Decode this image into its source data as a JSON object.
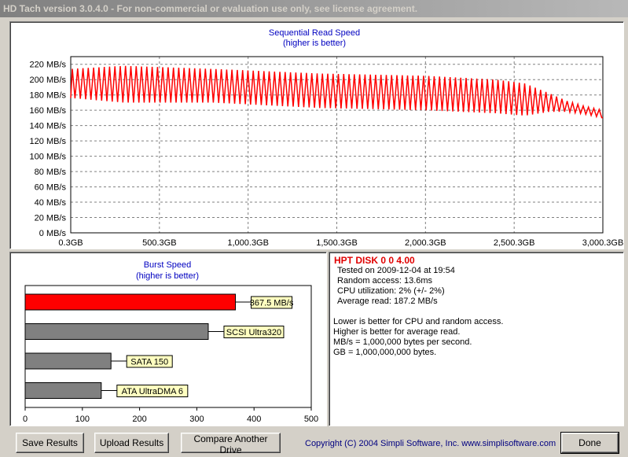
{
  "window": {
    "title": "HD Tach version 3.0.4.0  - For non-commercial or evaluation use only, see license agreement."
  },
  "chart_data": [
    {
      "type": "line",
      "title": "Sequential Read Speed",
      "subtitle": "(higher is better)",
      "ylim": [
        0,
        230
      ],
      "xlim": [
        0.3,
        3000.3
      ],
      "yticks": [
        "0 MB/s",
        "20 MB/s",
        "40 MB/s",
        "60 MB/s",
        "80 MB/s",
        "100 MB/s",
        "120 MB/s",
        "140 MB/s",
        "160 MB/s",
        "180 MB/s",
        "200 MB/s",
        "220 MB/s"
      ],
      "xticks": [
        "0.3GB",
        "500.3GB",
        "1,000.3GB",
        "1,500.3GB",
        "2,000.3GB",
        "2,500.3GB",
        "3,000.3GB"
      ],
      "xtick_values": [
        0.3,
        500.3,
        1000.3,
        1500.3,
        2000.3,
        2500.3,
        3000.3
      ],
      "grid": true,
      "series": [
        {
          "color": "#ff0000",
          "segments": 100,
          "x": [
            0.3,
            3000.3
          ],
          "peaks": [
            [
              0.3,
              214
            ],
            [
              300,
              218
            ],
            [
              800,
              214
            ],
            [
              1400,
              208
            ],
            [
              2000,
              205
            ],
            [
              2400,
              200
            ],
            [
              2560,
              195
            ],
            [
              2700,
              182
            ],
            [
              2800,
              172
            ],
            [
              2900,
              165
            ],
            [
              3000.3,
              160
            ]
          ],
          "troughs": [
            [
              0.3,
              176
            ],
            [
              300,
              170
            ],
            [
              800,
              170
            ],
            [
              1400,
              163
            ],
            [
              2000,
              160
            ],
            [
              2400,
              156
            ],
            [
              2560,
              153
            ],
            [
              2700,
              158
            ],
            [
              2800,
              158
            ],
            [
              2900,
              155
            ],
            [
              3000.3,
              150
            ]
          ],
          "start": 176,
          "end": 150
        }
      ]
    },
    {
      "type": "bar",
      "orientation": "horizontal",
      "title": "Burst Speed",
      "subtitle": "(higher is better)",
      "xlim": [
        0,
        500
      ],
      "xticks": [
        "0",
        "100",
        "200",
        "300",
        "400",
        "500"
      ],
      "xtick_values": [
        0,
        100,
        200,
        300,
        400,
        500
      ],
      "categories": [
        "367.5 MB/s",
        "SCSI Ultra320",
        "SATA 150",
        "ATA UltraDMA 6"
      ],
      "values": [
        367.5,
        320,
        150,
        133
      ],
      "colors": [
        "#ff0000",
        "#808080",
        "#808080",
        "#808080"
      ]
    }
  ],
  "info": {
    "drive": "HPT DISK 0 0 4.00",
    "tested": "Tested on 2009-12-04 at 19:54",
    "random_access": "Random access: 13.6ms",
    "cpu": "CPU utilization: 2% (+/- 2%)",
    "avg_read": "Average read: 187.2 MB/s",
    "notes": [
      "Lower is better for CPU and random access.",
      "Higher is better for average read.",
      "MB/s = 1,000,000 bytes per second.",
      "GB = 1,000,000,000 bytes."
    ]
  },
  "buttons": {
    "save": "Save Results",
    "upload": "Upload Results",
    "compare": "Compare Another Drive",
    "done": "Done"
  },
  "footer": {
    "copyright": "Copyright (C) 2004 Simpli Software, Inc. www.simplisoftware.com"
  }
}
